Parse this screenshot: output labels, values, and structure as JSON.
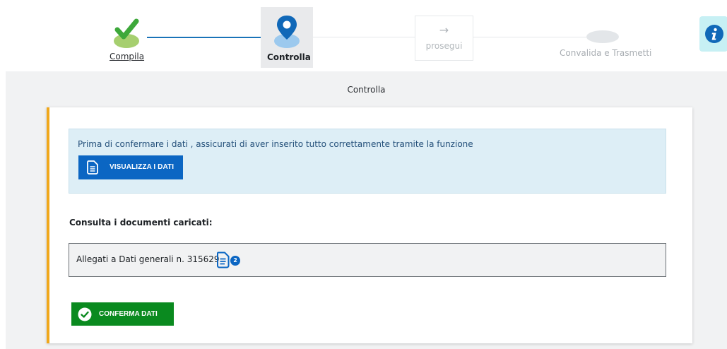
{
  "stepper": {
    "steps": [
      {
        "label": "Compila",
        "state": "completed",
        "icon": "check-icon"
      },
      {
        "label": "Controlla",
        "state": "active",
        "icon": "location-pin-icon"
      },
      {
        "label": "prosegui",
        "state": "disabled",
        "icon": "arrow-right-icon",
        "arrow": "→"
      },
      {
        "label": "Convalida e Trasmetti",
        "state": "pending",
        "icon": "step-placeholder-icon"
      }
    ],
    "info_icon": "info-icon"
  },
  "section": {
    "title": "Controlla"
  },
  "alert": {
    "text": "Prima di confermare i dati , assicurati di aver inserito tutto correttamente tramite la funzione",
    "button_label": "VISUALIZZA I DATI",
    "button_icon": "document-icon"
  },
  "documents": {
    "heading": "Consulta i documenti caricati:",
    "attachment_label": "Allegati a Dati generali n. 315629",
    "attachment_count": "2",
    "attachment_icon": "document-icon"
  },
  "confirm": {
    "label": "CONFERMA DATI",
    "icon": "check-circle-icon"
  },
  "colors": {
    "primary": "#0b66c3",
    "success": "#0a8a1f",
    "accent": "#f0a81c",
    "alert_bg": "#ddeef6",
    "stepper_line": "#1a73b8"
  }
}
